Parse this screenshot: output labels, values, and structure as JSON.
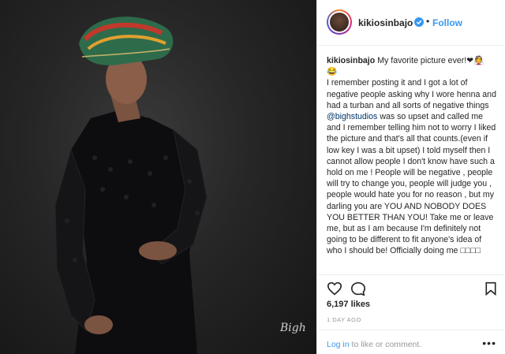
{
  "post": {
    "username": "kikiosinbajo",
    "dot": "•",
    "follow_label": "Follow",
    "caption": {
      "username": "kikiosinbajo",
      "text_first": "My favorite picture ever!❤👰",
      "text_second": "😂",
      "body_before_mention": "I remember posting it and I got a lot of negative people asking why I wore henna and had a turban and all sorts of negative things",
      "mention": "@bighstudios",
      "body_after_mention": "was so upset and called me and I remember telling him not to worry I liked the picture and that's all that counts.(even if low key I was a bit upset) I told myself then I cannot allow people I don't know have such a hold on me ! People will be negative , people will try to change you, people will judge you , people would hate you for no reason , but my darling you are YOU AND NOBODY DOES YOU BETTER THAN YOU! Take me or leave me, but as I am because I'm definitely not going to be different to fit anyone's idea of who I should be! Officially doing me □□□□"
    },
    "likes": "6,197 likes",
    "time": "1 DAY AGO",
    "login_link": "Log in",
    "login_rest": " to like or comment.",
    "more_dots": "•••",
    "photo_signature": "Bigh"
  },
  "icons": {
    "heart": "heart-icon",
    "comment": "comment-icon",
    "bookmark": "bookmark-icon",
    "verified": "verified-badge-icon",
    "more": "more-options-icon"
  },
  "colors": {
    "link": "#3897f0",
    "mention": "#003569",
    "text": "#262626",
    "muted": "#999999"
  }
}
